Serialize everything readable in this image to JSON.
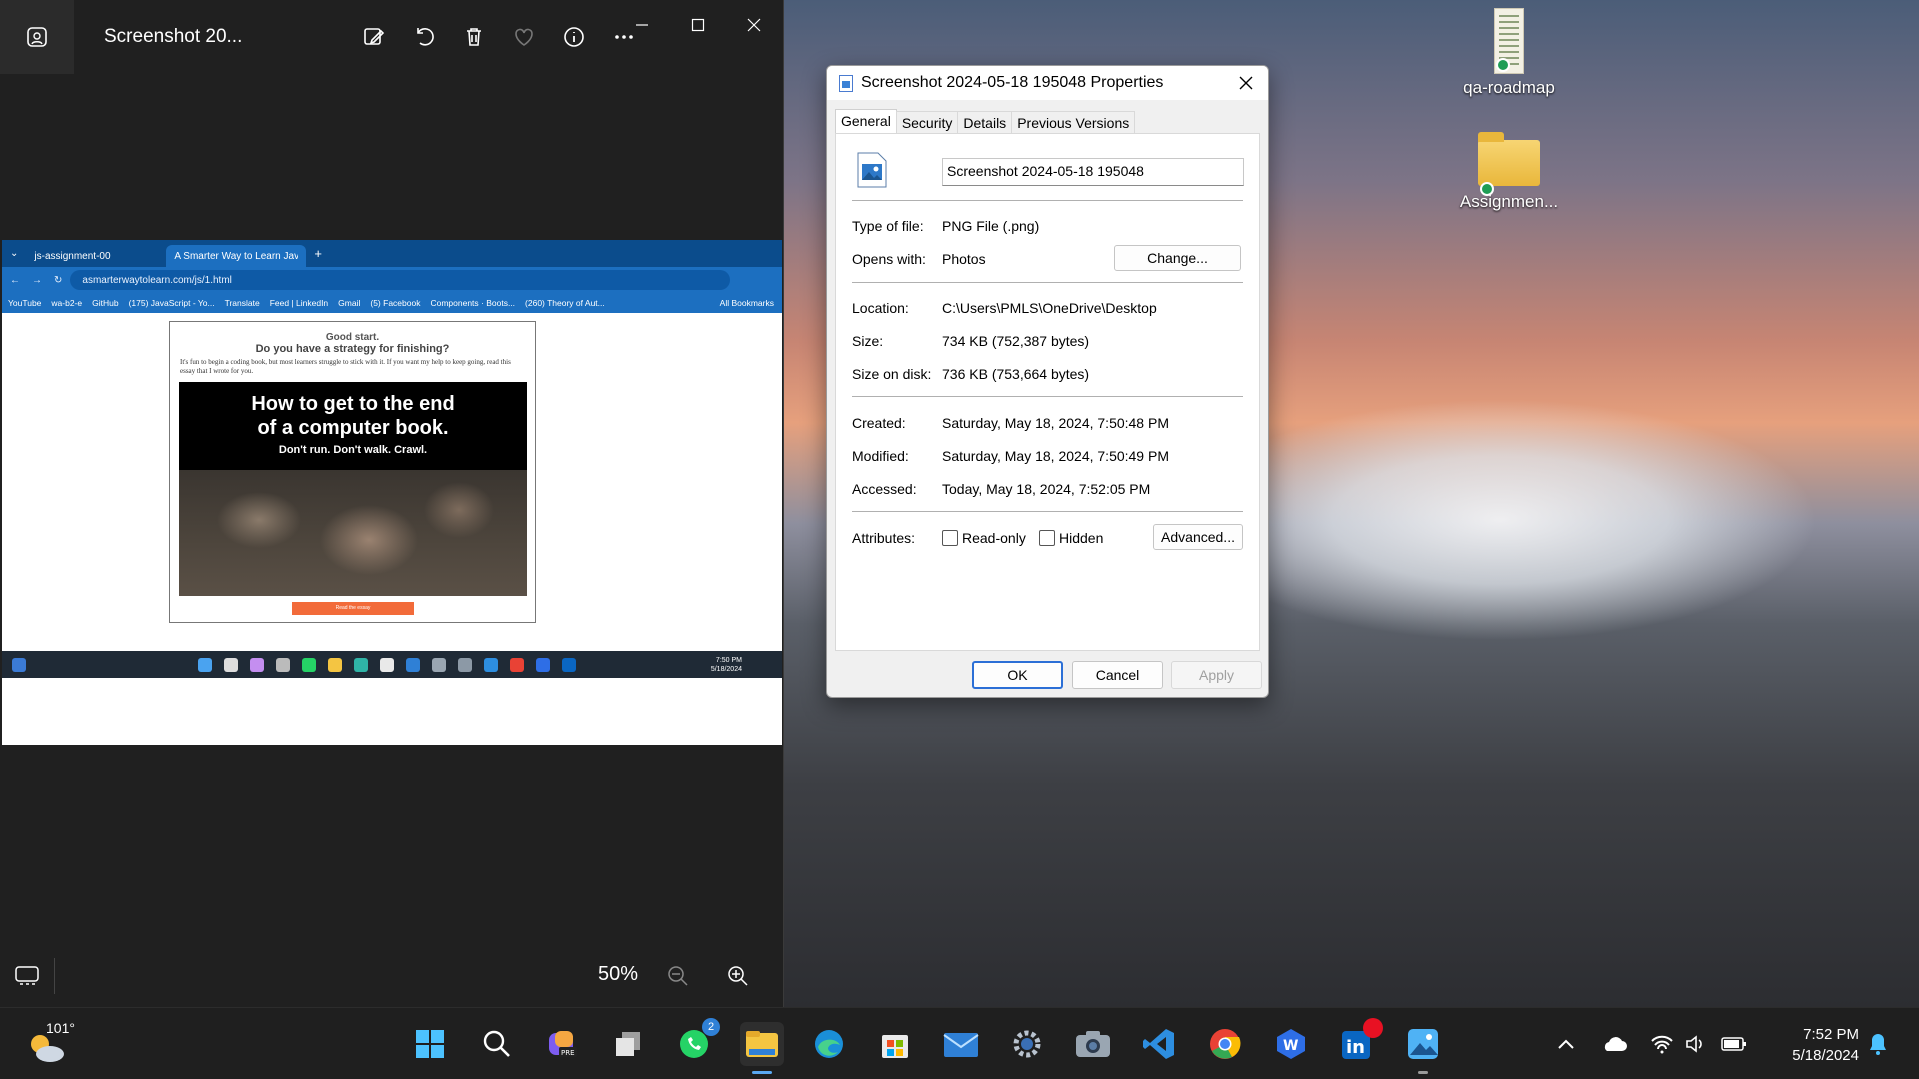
{
  "desktop": {
    "icons": [
      {
        "label": "qa-roadmap"
      },
      {
        "label": "Assignmen..."
      }
    ]
  },
  "photos": {
    "title": "Screenshot 20...",
    "zoom": "50%",
    "toolbar": [
      "edit-image",
      "rotate",
      "delete",
      "favorite",
      "info",
      "more"
    ],
    "inner": {
      "tabs": [
        "js-assignment-00",
        "A Smarter Way to Learn JavaSc"
      ],
      "url": "asmarterwaytolearn.com/js/1.html",
      "bookmarks": [
        "YouTube",
        "wa-b2-e",
        "GitHub",
        "(175) JavaScript - Yo...",
        "Translate",
        "Feed | LinkedIn",
        "Gmail",
        "(5) Facebook",
        "Components · Boots...",
        "(260) Theory of Aut..."
      ],
      "all_bookmarks": "All Bookmarks",
      "heading1": "Good start.",
      "heading2": "Do you have a strategy for finishing?",
      "paragraph": "It's fun to begin a coding book, but most learners struggle to stick with it. If you want my help to keep going, read this essay that I wrote for you.",
      "hero_line1": "How to get to the end",
      "hero_line2": "of a computer book.",
      "hero_sub": "Don't run. Don't walk. Crawl.",
      "button": "Read the essay",
      "clock_time": "7:50 PM",
      "clock_date": "5/18/2024"
    }
  },
  "props": {
    "title": "Screenshot 2024-05-18 195048 Properties",
    "tabs": [
      "General",
      "Security",
      "Details",
      "Previous Versions"
    ],
    "filename": "Screenshot 2024-05-18 195048",
    "type_label": "Type of file:",
    "type_value": "PNG File (.png)",
    "opens_label": "Opens with:",
    "opens_value": "Photos",
    "change_btn": "Change...",
    "location_label": "Location:",
    "location_value": "C:\\Users\\PMLS\\OneDrive\\Desktop",
    "size_label": "Size:",
    "size_value": "734 KB (752,387 bytes)",
    "sizedisk_label": "Size on disk:",
    "sizedisk_value": "736 KB (753,664 bytes)",
    "created_label": "Created:",
    "created_value": "Saturday, May 18, 2024, 7:50:48 PM",
    "modified_label": "Modified:",
    "modified_value": "Saturday, May 18, 2024, 7:50:49 PM",
    "accessed_label": "Accessed:",
    "accessed_value": "Today, May 18, 2024, 7:52:05 PM",
    "attributes_label": "Attributes:",
    "readonly_label": "Read-only",
    "readonly_checked": false,
    "hidden_label": "Hidden",
    "hidden_checked": false,
    "advanced_btn": "Advanced...",
    "ok_btn": "OK",
    "cancel_btn": "Cancel",
    "apply_btn": "Apply"
  },
  "taskbar": {
    "weather_temp": "101°",
    "whatsapp_badge": "2",
    "time": "7:52 PM",
    "date": "5/18/2024",
    "accent": "#5aa8f2"
  }
}
